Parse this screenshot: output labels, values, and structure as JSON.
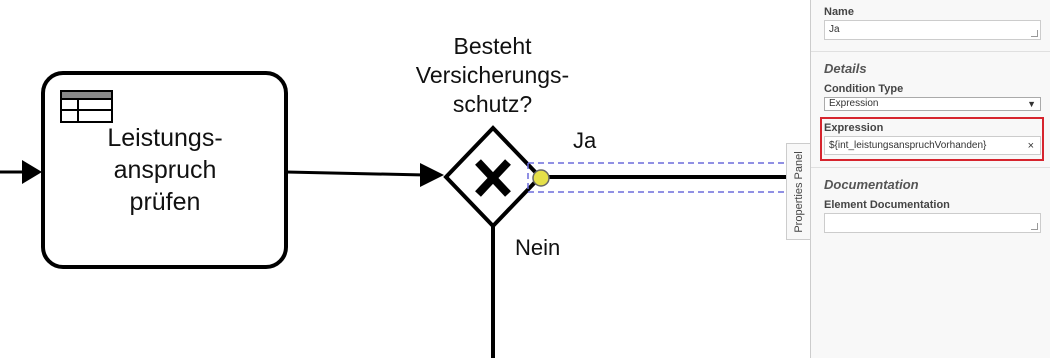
{
  "diagram": {
    "task": {
      "label": "Leistungs-\nanspruch\nprüfen"
    },
    "gateway": {
      "label": "Besteht\nVersicherungs-\nschutz?",
      "marker": "X"
    },
    "flows": {
      "yes": "Ja",
      "no": "Nein"
    },
    "icons": {
      "task_type": "table-icon",
      "gateway_marker": "x-marker-icon"
    }
  },
  "panel": {
    "toggle_label": "Properties Panel",
    "name": {
      "label": "Name",
      "value": "Ja"
    },
    "details": {
      "title": "Details",
      "condition_type": {
        "label": "Condition Type",
        "value": "Expression"
      },
      "expression": {
        "label": "Expression",
        "value": "${int_leistungsanspruchVorhanden}",
        "clear": "×"
      }
    },
    "documentation": {
      "title": "Documentation",
      "element_documentation": {
        "label": "Element Documentation",
        "value": ""
      }
    }
  },
  "colors": {
    "highlight": "#d6242d",
    "selection": "#6b6bdb",
    "handle": "#e5e04a"
  }
}
